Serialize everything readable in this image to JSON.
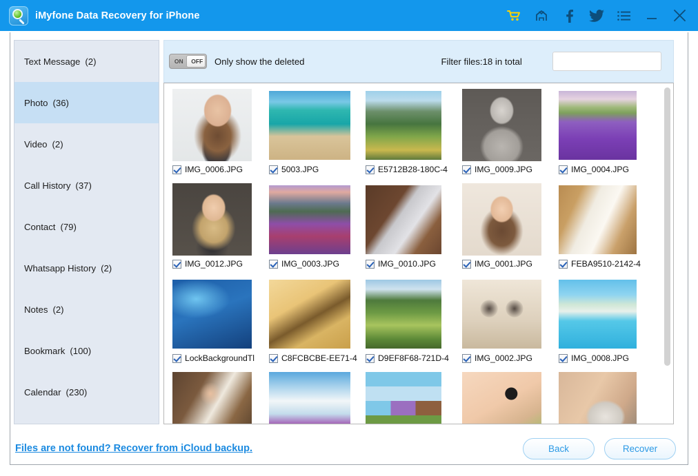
{
  "window": {
    "title": "iMyfone Data Recovery for iPhone",
    "app_icon": "magnifier-app-icon",
    "titlebar_color": "#1397ec",
    "controls": [
      {
        "name": "cart-icon",
        "label": "Cart",
        "color": "#ffd400"
      },
      {
        "name": "home-icon",
        "label": "Home"
      },
      {
        "name": "facebook-icon",
        "label": "Facebook"
      },
      {
        "name": "twitter-icon",
        "label": "Twitter"
      },
      {
        "name": "menu-icon",
        "label": "Menu"
      },
      {
        "name": "minimize-button",
        "label": "Minimize"
      },
      {
        "name": "close-button",
        "label": "Close"
      }
    ]
  },
  "sidebar": {
    "selected": "Photo",
    "items": [
      {
        "label": "Text Message",
        "count": "(2)",
        "selected": false
      },
      {
        "label": "Photo",
        "count": "(36)",
        "selected": true
      },
      {
        "label": "Video",
        "count": "(2)",
        "selected": false
      },
      {
        "label": "Call History",
        "count": "(37)",
        "selected": false
      },
      {
        "label": "Contact",
        "count": "(79)",
        "selected": false
      },
      {
        "label": "Whatsapp History",
        "count": "(2)",
        "selected": false
      },
      {
        "label": "Notes",
        "count": "(2)",
        "selected": false
      },
      {
        "label": "Bookmark",
        "count": "(100)",
        "selected": false
      },
      {
        "label": "Calendar",
        "count": "(230)",
        "selected": false
      }
    ]
  },
  "toolbar": {
    "toggle_on_label": "ON",
    "toggle_off_label": "OFF",
    "toggle_state": "OFF",
    "toggle_caption": "Only show the deleted",
    "filter_text": "Filter files:18 in total",
    "search_value": "",
    "search_placeholder": ""
  },
  "grid": {
    "rows": [
      [
        {
          "name": "IMG_0006.JPG",
          "checked": true,
          "thumb": "portrait-woman-long-hair"
        },
        {
          "name": "5003.JPG",
          "checked": true,
          "thumb": "tropical-pier-ocean"
        },
        {
          "name": "E5712B28-180C-4",
          "checked": true,
          "thumb": "green-mountain-valley"
        },
        {
          "name": "IMG_0009.JPG",
          "checked": true,
          "thumb": "bw-woman-brick-wall"
        },
        {
          "name": "IMG_0004.JPG",
          "checked": true,
          "thumb": "lavender-field-rows"
        }
      ],
      [
        {
          "name": "IMG_0012.JPG",
          "checked": true,
          "thumb": "smiling-blonde-woman"
        },
        {
          "name": "IMG_0003.JPG",
          "checked": true,
          "thumb": "mountain-wildflowers-lake"
        },
        {
          "name": "IMG_0010.JPG",
          "checked": true,
          "thumb": "laptop-desk-hands"
        },
        {
          "name": "IMG_0001.JPG",
          "checked": true,
          "thumb": "portrait-brunette-woman"
        },
        {
          "name": "FEBA9510-2142-4",
          "checked": true,
          "thumb": "notebook-pen-desk"
        }
      ],
      [
        {
          "name": "LockBackgroundTl",
          "checked": true,
          "thumb": "blue-abstract-wallpaper"
        },
        {
          "name": "C8FCBCBE-EE71-4",
          "checked": true,
          "thumb": "fountain-pen-golden"
        },
        {
          "name": "D9EF8F68-721D-4",
          "checked": true,
          "thumb": "green-valley-river"
        },
        {
          "name": "IMG_0002.JPG",
          "checked": true,
          "thumb": "eyeglasses-on-book"
        },
        {
          "name": "IMG_0008.JPG",
          "checked": true,
          "thumb": "pool-resort-palm"
        }
      ],
      [
        {
          "name": "",
          "checked": false,
          "thumb": "man-writing-study"
        },
        {
          "name": "",
          "checked": false,
          "thumb": "clouds-tulip-field"
        },
        {
          "name": "",
          "checked": false,
          "thumb": "photo-collage-grid"
        },
        {
          "name": "",
          "checked": false,
          "thumb": "child-glasses-closeup"
        },
        {
          "name": "",
          "checked": false,
          "thumb": "bearded-man-closeup"
        }
      ]
    ]
  },
  "footer": {
    "cloud_link": "Files are not found? Recover from iCloud backup.",
    "back_label": "Back",
    "recover_label": "Recover"
  }
}
